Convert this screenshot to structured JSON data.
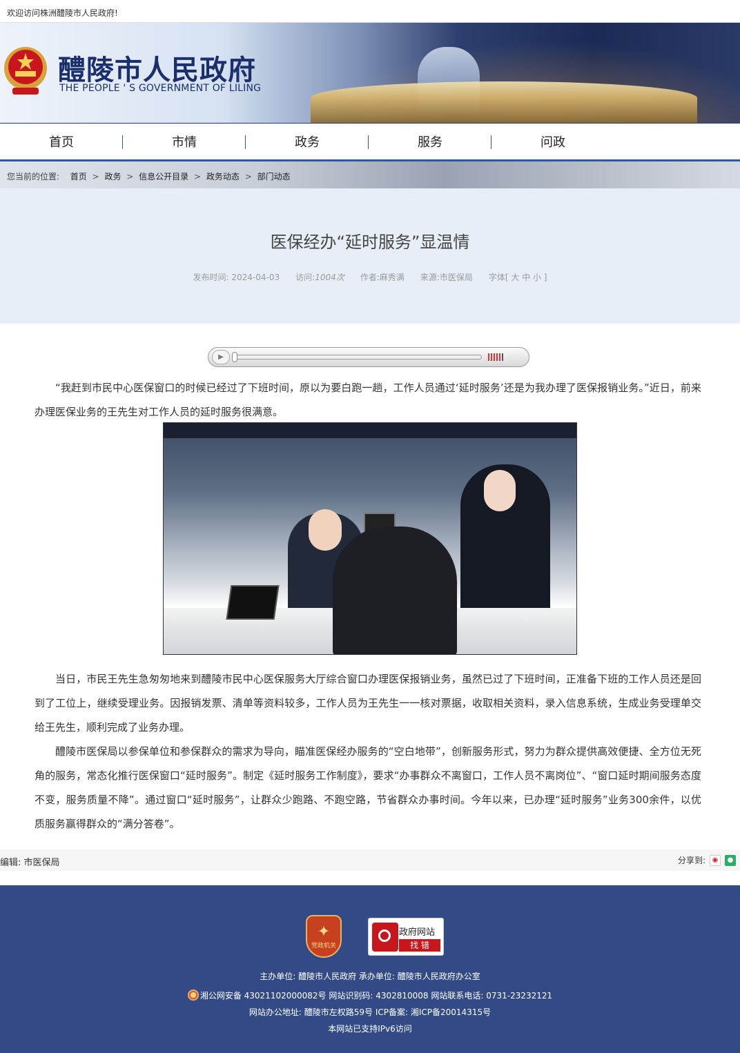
{
  "topbar": {
    "welcome": "欢迎访问株洲醴陵市人民政府!"
  },
  "header": {
    "title_cn": "醴陵市人民政府",
    "title_en": "THE PEOPLE ' S GOVERNMENT OF LILING",
    "emblem_icon": "national-emblem-icon"
  },
  "nav": {
    "items": [
      "首页",
      "市情",
      "政务",
      "服务",
      "问政"
    ]
  },
  "breadcrumb": {
    "label": "您当前的位置:",
    "items": [
      "首页",
      "政务",
      "信息公开目录",
      "政务动态",
      "部门动态"
    ],
    "arrow": ">"
  },
  "article": {
    "title": "医保经办“延时服务”显温情",
    "meta": {
      "date": "发布时间:  2024-04-03",
      "views_label": "访问:",
      "views_value": "1004次",
      "author": "作者:麻秀满",
      "source": "来源:市医保局",
      "font_size": "字体[ 大 中 小 ]"
    },
    "player": {
      "play_icon": "play-icon",
      "volume_icon": "volume-icon",
      "progress": 0
    },
    "paragraphs": [
      "“我赶到市民中心医保窗口的时候已经过了下班时间，原以为要白跑一趟，工作人员通过‘延时服务’还是为我办理了医保报销业务。”近日，前来办理医保业务的王先生对工作人员的延时服务很满意。",
      "当日，市民王先生急匆匆地来到醴陵市民中心医保服务大厅综合窗口办理医保报销业务，虽然已过了下班时间，正准备下班的工作人员还是回到了工位上，继续受理业务。因报销发票、清单等资料较多，工作人员为王先生一一核对票据，收取相关资料，录入信息系统，生成业务受理单交给王先生，顺利完成了业务办理。",
      "醴陵市医保局以参保单位和参保群众的需求为导向，瞄准医保经办服务的“空白地带”，创新服务形式，努力为群众提供高效便捷、全方位无死角的服务，常态化推行医保窗口“延时服务”。制定《延时服务工作制度》，要求“办事群众不离窗口，工作人员不离岗位”、“窗口延时期间服务态度不变，服务质量不降”。通过窗口“延时服务”，让群众少跑路、不跑空路，节省群众办事时间。今年以来，已办理“延时服务”业务300余件，以优质服务赢得群众的“满分答卷”。"
    ],
    "photo_name": "service-window-photo"
  },
  "editor": {
    "label": "编辑:  市医保局",
    "share_label": "分享到:",
    "share_icons": [
      "weibo-icon",
      "wechat-icon"
    ]
  },
  "footer": {
    "badge1_text": "党政机关",
    "badge2_line1": "政府网站",
    "badge2_line2": "找 错",
    "line1": "主办单位:  醴陵市人民政府  承办单位:  醴陵市人民政府办公室",
    "line2": "湘公网安备 43021102000082号  网站识别码:  4302810008  网站联系电话:  0731-23232121",
    "line3": "网站办公地址:  醴陵市左权路59号    ICP备案:  湘ICP备20014315号",
    "line4": "本网站已支持IPv6访问"
  }
}
